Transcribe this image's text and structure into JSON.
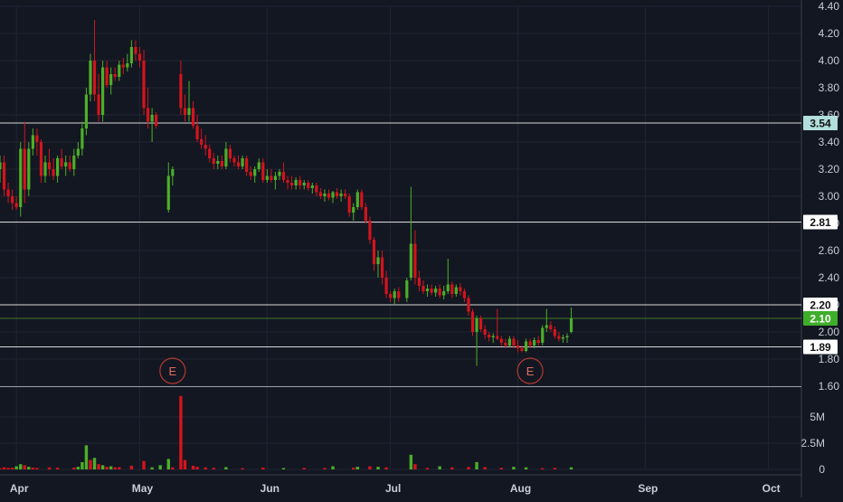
{
  "colors": {
    "background": "#131722",
    "grid": "#1f2433",
    "axis_text": "#c8ccd6",
    "up": "#4caf28",
    "down": "#d4141c",
    "hline": "#d8d8d8",
    "current_line": "#3d7a2a",
    "earnings": "#b23a2e",
    "highlight_label": "#b2dfdb",
    "current_label": "#3fae2a"
  },
  "chart_data": {
    "type": "candlestick",
    "y_price": {
      "min": 1.6,
      "max": 4.4,
      "ticks": [
        "4.40",
        "4.20",
        "4.00",
        "3.80",
        "3.60",
        "3.40",
        "3.20",
        "3.00",
        "2.80",
        "2.60",
        "2.40",
        "2.20",
        "2.00",
        "1.80",
        "1.60"
      ]
    },
    "y_volume": {
      "max": 7500000,
      "ticks": [
        "5M",
        "2.5M",
        "0"
      ]
    },
    "x_axis": {
      "labels": [
        {
          "text": "Apr",
          "day": 0
        },
        {
          "text": "May",
          "day": 30
        },
        {
          "text": "Jun",
          "day": 61
        },
        {
          "text": "Jul",
          "day": 91
        },
        {
          "text": "Aug",
          "day": 122
        },
        {
          "text": "Sep",
          "day": 153
        },
        {
          "text": "Oct",
          "day": 183
        }
      ],
      "day_range": [
        -4,
        191
      ]
    },
    "horizontal_lines": [
      {
        "value": 3.54,
        "label": "3.54",
        "style": "highlight"
      },
      {
        "value": 2.81,
        "label": "2.81",
        "style": "normal"
      },
      {
        "value": 2.2,
        "label": "2.20",
        "style": "normal"
      },
      {
        "value": 2.1,
        "label": "2.10",
        "style": "current"
      },
      {
        "value": 1.89,
        "label": "1.89",
        "style": "normal"
      }
    ],
    "earnings": [
      {
        "day": 38,
        "label": "E"
      },
      {
        "day": 125,
        "label": "E"
      }
    ],
    "ohlc": [
      [
        -4,
        3.2,
        3.3,
        3.1,
        3.25
      ],
      [
        -3,
        3.25,
        3.3,
        3.0,
        3.05
      ],
      [
        -2,
        3.05,
        3.1,
        2.95,
        3.0
      ],
      [
        -1,
        3.0,
        3.05,
        2.9,
        2.95
      ],
      [
        0,
        2.95,
        3.0,
        2.9,
        2.92
      ],
      [
        1,
        2.92,
        3.4,
        2.85,
        3.35
      ],
      [
        2,
        3.35,
        3.55,
        2.95,
        3.05
      ],
      [
        3,
        3.05,
        3.4,
        3.0,
        3.35
      ],
      [
        4,
        3.35,
        3.5,
        3.3,
        3.45
      ],
      [
        5,
        3.45,
        3.5,
        3.3,
        3.4
      ],
      [
        6,
        3.4,
        3.42,
        3.1,
        3.15
      ],
      [
        7,
        3.15,
        3.3,
        3.1,
        3.25
      ],
      [
        8,
        3.25,
        3.35,
        3.15,
        3.2
      ],
      [
        9,
        3.2,
        3.28,
        3.12,
        3.15
      ],
      [
        10,
        3.15,
        3.3,
        3.1,
        3.28
      ],
      [
        11,
        3.28,
        3.35,
        3.2,
        3.22
      ],
      [
        12,
        3.22,
        3.3,
        3.15,
        3.25
      ],
      [
        13,
        3.25,
        3.3,
        3.18,
        3.2
      ],
      [
        14,
        3.2,
        3.35,
        3.15,
        3.3
      ],
      [
        15,
        3.3,
        3.4,
        3.28,
        3.35
      ],
      [
        16,
        3.35,
        3.55,
        3.3,
        3.5
      ],
      [
        17,
        3.5,
        3.8,
        3.45,
        3.75
      ],
      [
        18,
        3.75,
        4.05,
        3.7,
        4.0
      ],
      [
        19,
        4.0,
        4.3,
        3.7,
        3.75
      ],
      [
        20,
        3.75,
        3.9,
        3.55,
        3.6
      ],
      [
        21,
        3.6,
        4.0,
        3.55,
        3.95
      ],
      [
        22,
        3.95,
        4.0,
        3.8,
        3.82
      ],
      [
        23,
        3.82,
        3.95,
        3.75,
        3.9
      ],
      [
        24,
        3.9,
        3.95,
        3.85,
        3.88
      ],
      [
        25,
        3.88,
        4.0,
        3.85,
        3.97
      ],
      [
        26,
        3.97,
        4.02,
        3.9,
        3.95
      ],
      [
        27,
        3.95,
        4.05,
        3.92,
        3.98
      ],
      [
        28,
        3.98,
        4.15,
        3.95,
        4.1
      ],
      [
        29,
        4.1,
        4.15,
        4.0,
        4.05
      ],
      [
        30,
        4.05,
        4.1,
        3.95,
        4.0
      ],
      [
        31,
        4.0,
        4.08,
        3.6,
        3.65
      ],
      [
        32,
        3.65,
        3.8,
        3.5,
        3.55
      ],
      [
        33,
        3.55,
        3.65,
        3.4,
        3.6
      ],
      [
        34,
        3.6,
        3.62,
        3.5,
        3.52
      ],
      [
        37,
        2.9,
        3.25,
        2.88,
        3.15
      ],
      [
        38,
        3.15,
        3.22,
        3.08,
        3.2
      ],
      [
        40,
        3.9,
        4.0,
        3.6,
        3.65
      ],
      [
        41,
        3.65,
        3.75,
        3.55,
        3.6
      ],
      [
        42,
        3.6,
        3.85,
        3.55,
        3.65
      ],
      [
        43,
        3.65,
        3.7,
        3.5,
        3.52
      ],
      [
        44,
        3.52,
        3.6,
        3.4,
        3.42
      ],
      [
        45,
        3.42,
        3.5,
        3.35,
        3.38
      ],
      [
        46,
        3.38,
        3.45,
        3.3,
        3.35
      ],
      [
        47,
        3.35,
        3.38,
        3.25,
        3.28
      ],
      [
        48,
        3.28,
        3.32,
        3.2,
        3.24
      ],
      [
        49,
        3.24,
        3.3,
        3.2,
        3.26
      ],
      [
        50,
        3.26,
        3.3,
        3.2,
        3.22
      ],
      [
        51,
        3.22,
        3.4,
        3.2,
        3.35
      ],
      [
        52,
        3.35,
        3.38,
        3.25,
        3.28
      ],
      [
        53,
        3.28,
        3.3,
        3.22,
        3.25
      ],
      [
        54,
        3.25,
        3.3,
        3.2,
        3.22
      ],
      [
        55,
        3.22,
        3.3,
        3.2,
        3.28
      ],
      [
        56,
        3.28,
        3.3,
        3.15,
        3.18
      ],
      [
        57,
        3.18,
        3.22,
        3.12,
        3.15
      ],
      [
        58,
        3.15,
        3.22,
        3.1,
        3.2
      ],
      [
        59,
        3.2,
        3.28,
        3.18,
        3.25
      ],
      [
        60,
        3.25,
        3.28,
        3.1,
        3.12
      ],
      [
        61,
        3.12,
        3.2,
        3.1,
        3.15
      ],
      [
        62,
        3.15,
        3.2,
        3.1,
        3.12
      ],
      [
        63,
        3.12,
        3.18,
        3.05,
        3.15
      ],
      [
        64,
        3.15,
        3.2,
        3.12,
        3.18
      ],
      [
        65,
        3.18,
        3.25,
        3.1,
        3.12
      ],
      [
        66,
        3.12,
        3.15,
        3.05,
        3.1
      ],
      [
        67,
        3.1,
        3.15,
        3.05,
        3.08
      ],
      [
        68,
        3.08,
        3.14,
        3.05,
        3.12
      ],
      [
        69,
        3.12,
        3.15,
        3.05,
        3.08
      ],
      [
        70,
        3.08,
        3.12,
        3.05,
        3.1
      ],
      [
        71,
        3.1,
        3.12,
        3.04,
        3.06
      ],
      [
        72,
        3.06,
        3.1,
        3.02,
        3.08
      ],
      [
        73,
        3.08,
        3.1,
        3.0,
        3.03
      ],
      [
        74,
        3.03,
        3.06,
        2.98,
        3.0
      ],
      [
        75,
        3.0,
        3.05,
        2.96,
        3.02
      ],
      [
        76,
        3.02,
        3.05,
        2.97,
        2.99
      ],
      [
        77,
        2.99,
        3.04,
        2.95,
        3.03
      ],
      [
        78,
        3.03,
        3.06,
        2.98,
        3.0
      ],
      [
        79,
        3.0,
        3.05,
        2.96,
        3.02
      ],
      [
        80,
        3.02,
        3.05,
        2.98,
        3.0
      ],
      [
        81,
        3.0,
        3.02,
        2.85,
        2.88
      ],
      [
        82,
        2.88,
        2.95,
        2.82,
        2.92
      ],
      [
        83,
        2.92,
        3.05,
        2.9,
        3.03
      ],
      [
        84,
        3.03,
        3.05,
        2.9,
        2.92
      ],
      [
        85,
        2.92,
        2.95,
        2.8,
        2.82
      ],
      [
        86,
        2.82,
        2.85,
        2.65,
        2.68
      ],
      [
        87,
        2.68,
        2.7,
        2.45,
        2.5
      ],
      [
        88,
        2.5,
        2.6,
        2.4,
        2.55
      ],
      [
        89,
        2.55,
        2.6,
        2.35,
        2.4
      ],
      [
        90,
        2.4,
        2.45,
        2.25,
        2.28
      ],
      [
        91,
        2.28,
        2.3,
        2.22,
        2.25
      ],
      [
        92,
        2.25,
        2.32,
        2.2,
        2.3
      ],
      [
        93,
        2.3,
        2.33,
        2.22,
        2.25
      ],
      [
        95,
        2.25,
        2.4,
        2.22,
        2.38
      ],
      [
        96,
        2.4,
        3.07,
        2.38,
        2.65
      ],
      [
        97,
        2.65,
        2.75,
        2.35,
        2.4
      ],
      [
        98,
        2.4,
        2.45,
        2.3,
        2.34
      ],
      [
        99,
        2.34,
        2.38,
        2.28,
        2.3
      ],
      [
        100,
        2.3,
        2.35,
        2.26,
        2.32
      ],
      [
        101,
        2.32,
        2.35,
        2.27,
        2.29
      ],
      [
        102,
        2.29,
        2.34,
        2.26,
        2.32
      ],
      [
        103,
        2.32,
        2.35,
        2.25,
        2.27
      ],
      [
        104,
        2.27,
        2.34,
        2.24,
        2.3
      ],
      [
        105,
        2.3,
        2.54,
        2.28,
        2.35
      ],
      [
        106,
        2.35,
        2.37,
        2.25,
        2.28
      ],
      [
        107,
        2.28,
        2.35,
        2.26,
        2.33
      ],
      [
        108,
        2.33,
        2.36,
        2.27,
        2.3
      ],
      [
        109,
        2.3,
        2.32,
        2.22,
        2.25
      ],
      [
        110,
        2.25,
        2.27,
        2.12,
        2.15
      ],
      [
        111,
        2.15,
        2.17,
        1.97,
        2.0
      ],
      [
        112,
        2.0,
        2.12,
        1.75,
        2.1
      ],
      [
        113,
        2.1,
        2.12,
        2.0,
        2.02
      ],
      [
        114,
        2.02,
        2.05,
        1.95,
        1.98
      ],
      [
        115,
        1.98,
        2.0,
        1.93,
        1.96
      ],
      [
        116,
        1.96,
        1.99,
        1.92,
        1.97
      ],
      [
        117,
        1.97,
        2.17,
        1.94,
        1.95
      ],
      [
        118,
        1.95,
        1.97,
        1.9,
        1.92
      ],
      [
        119,
        1.92,
        1.95,
        1.88,
        1.9
      ],
      [
        120,
        1.9,
        1.97,
        1.89,
        1.95
      ],
      [
        121,
        1.95,
        1.97,
        1.88,
        1.9
      ],
      [
        122,
        1.9,
        1.94,
        1.85,
        1.88
      ],
      [
        123,
        1.88,
        1.9,
        1.85,
        1.86
      ],
      [
        124,
        1.86,
        1.95,
        1.85,
        1.93
      ],
      [
        125,
        1.93,
        1.95,
        1.88,
        1.9
      ],
      [
        126,
        1.9,
        1.96,
        1.88,
        1.94
      ],
      [
        127,
        1.94,
        1.97,
        1.9,
        1.92
      ],
      [
        128,
        1.92,
        2.05,
        1.9,
        2.03
      ],
      [
        129,
        2.03,
        2.17,
        2.0,
        2.05
      ],
      [
        130,
        2.05,
        2.08,
        2.0,
        2.02
      ],
      [
        131,
        2.02,
        2.04,
        1.95,
        1.97
      ],
      [
        132,
        1.97,
        2.0,
        1.93,
        1.95
      ],
      [
        133,
        1.95,
        1.98,
        1.92,
        1.96
      ],
      [
        134,
        1.96,
        1.99,
        1.92,
        1.97
      ],
      [
        135,
        2.0,
        2.18,
        1.99,
        2.1
      ]
    ],
    "volume": [
      [
        -4,
        120000,
        "down"
      ],
      [
        -3,
        200000,
        "down"
      ],
      [
        -2,
        150000,
        "down"
      ],
      [
        -1,
        160000,
        "down"
      ],
      [
        0,
        300000,
        "up"
      ],
      [
        1,
        500000,
        "up"
      ],
      [
        2,
        400000,
        "down"
      ],
      [
        3,
        250000,
        "up"
      ],
      [
        4,
        180000,
        "down"
      ],
      [
        5,
        150000,
        "down"
      ],
      [
        8,
        200000,
        "down"
      ],
      [
        10,
        170000,
        "down"
      ],
      [
        14,
        180000,
        "down"
      ],
      [
        15,
        250000,
        "up"
      ],
      [
        16,
        700000,
        "up"
      ],
      [
        17,
        2300000,
        "up"
      ],
      [
        18,
        900000,
        "down"
      ],
      [
        19,
        1100000,
        "up"
      ],
      [
        20,
        500000,
        "down"
      ],
      [
        21,
        400000,
        "up"
      ],
      [
        22,
        260000,
        "down"
      ],
      [
        23,
        300000,
        "up"
      ],
      [
        24,
        200000,
        "down"
      ],
      [
        25,
        220000,
        "down"
      ],
      [
        28,
        350000,
        "down"
      ],
      [
        31,
        800000,
        "down"
      ],
      [
        33,
        200000,
        "up"
      ],
      [
        35,
        400000,
        "up"
      ],
      [
        37,
        1000000,
        "up"
      ],
      [
        38,
        200000,
        "down"
      ],
      [
        40,
        7000000,
        "down"
      ],
      [
        41,
        900000,
        "down"
      ],
      [
        43,
        350000,
        "down"
      ],
      [
        44,
        250000,
        "down"
      ],
      [
        46,
        200000,
        "down"
      ],
      [
        48,
        160000,
        "down"
      ],
      [
        51,
        220000,
        "up"
      ],
      [
        55,
        120000,
        "down"
      ],
      [
        60,
        180000,
        "down"
      ],
      [
        65,
        130000,
        "up"
      ],
      [
        70,
        150000,
        "down"
      ],
      [
        75,
        140000,
        "down"
      ],
      [
        77,
        300000,
        "up"
      ],
      [
        82,
        170000,
        "down"
      ],
      [
        83,
        250000,
        "up"
      ],
      [
        86,
        300000,
        "down"
      ],
      [
        88,
        250000,
        "up"
      ],
      [
        90,
        200000,
        "down"
      ],
      [
        96,
        1400000,
        "up"
      ],
      [
        97,
        500000,
        "down"
      ],
      [
        100,
        150000,
        "down"
      ],
      [
        103,
        300000,
        "up"
      ],
      [
        106,
        200000,
        "down"
      ],
      [
        110,
        230000,
        "down"
      ],
      [
        112,
        700000,
        "up"
      ],
      [
        114,
        220000,
        "down"
      ],
      [
        118,
        150000,
        "down"
      ],
      [
        121,
        250000,
        "up"
      ],
      [
        124,
        200000,
        "up"
      ],
      [
        128,
        120000,
        "down"
      ],
      [
        131,
        150000,
        "down"
      ],
      [
        135,
        200000,
        "up"
      ]
    ]
  }
}
